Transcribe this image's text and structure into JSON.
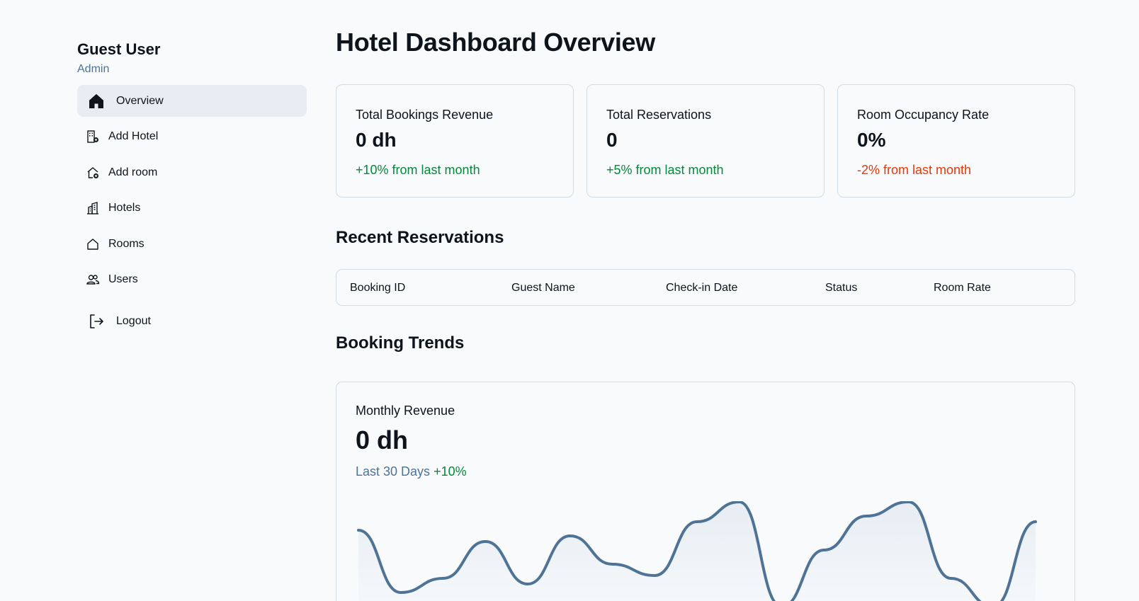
{
  "sidebar": {
    "user_name": "Guest User",
    "user_role": "Admin",
    "items": [
      {
        "label": "Overview",
        "icon": "house-icon",
        "active": true
      },
      {
        "label": "Add Hotel",
        "icon": "building-add-icon"
      },
      {
        "label": "Add room",
        "icon": "house-add-icon"
      },
      {
        "label": "Hotels",
        "icon": "buildings-icon"
      },
      {
        "label": "Rooms",
        "icon": "house-outline-icon"
      },
      {
        "label": "Users",
        "icon": "users-icon"
      }
    ],
    "logout_label": "Logout"
  },
  "main": {
    "title": "Hotel Dashboard Overview",
    "stats": [
      {
        "label": "Total Bookings Revenue",
        "value": "0 dh",
        "delta": "+10% from last month",
        "trend": "positive"
      },
      {
        "label": "Total Reservations",
        "value": "0",
        "delta": "+5% from last month",
        "trend": "positive"
      },
      {
        "label": "Room Occupancy Rate",
        "value": "0%",
        "delta": "-2% from last month",
        "trend": "negative"
      }
    ],
    "reservations": {
      "title": "Recent Reservations",
      "columns": [
        "Booking ID",
        "Guest Name",
        "Check-in Date",
        "Status",
        "Room Rate"
      ]
    },
    "trends": {
      "title": "Booking Trends",
      "chart_title": "Monthly Revenue",
      "chart_value": "0 dh",
      "period": "Last 30 Days",
      "delta": "+10%"
    }
  },
  "colors": {
    "accent": "#4e7397",
    "positive": "#07883b",
    "negative": "#e73908",
    "border": "#d0dbe7",
    "active_bg": "#e7edf3"
  },
  "chart_data": {
    "type": "area",
    "title": "Monthly Revenue",
    "x": [
      0,
      1,
      2,
      3,
      4,
      5,
      6,
      7,
      8,
      9,
      10,
      11,
      12,
      13,
      14,
      15,
      16
    ],
    "values": [
      109,
      21,
      41,
      93,
      33,
      101,
      61,
      45,
      121,
      149,
      1,
      81,
      129,
      149,
      41,
      1,
      121
    ],
    "xlabel": "",
    "ylabel": "",
    "grid": false
  }
}
